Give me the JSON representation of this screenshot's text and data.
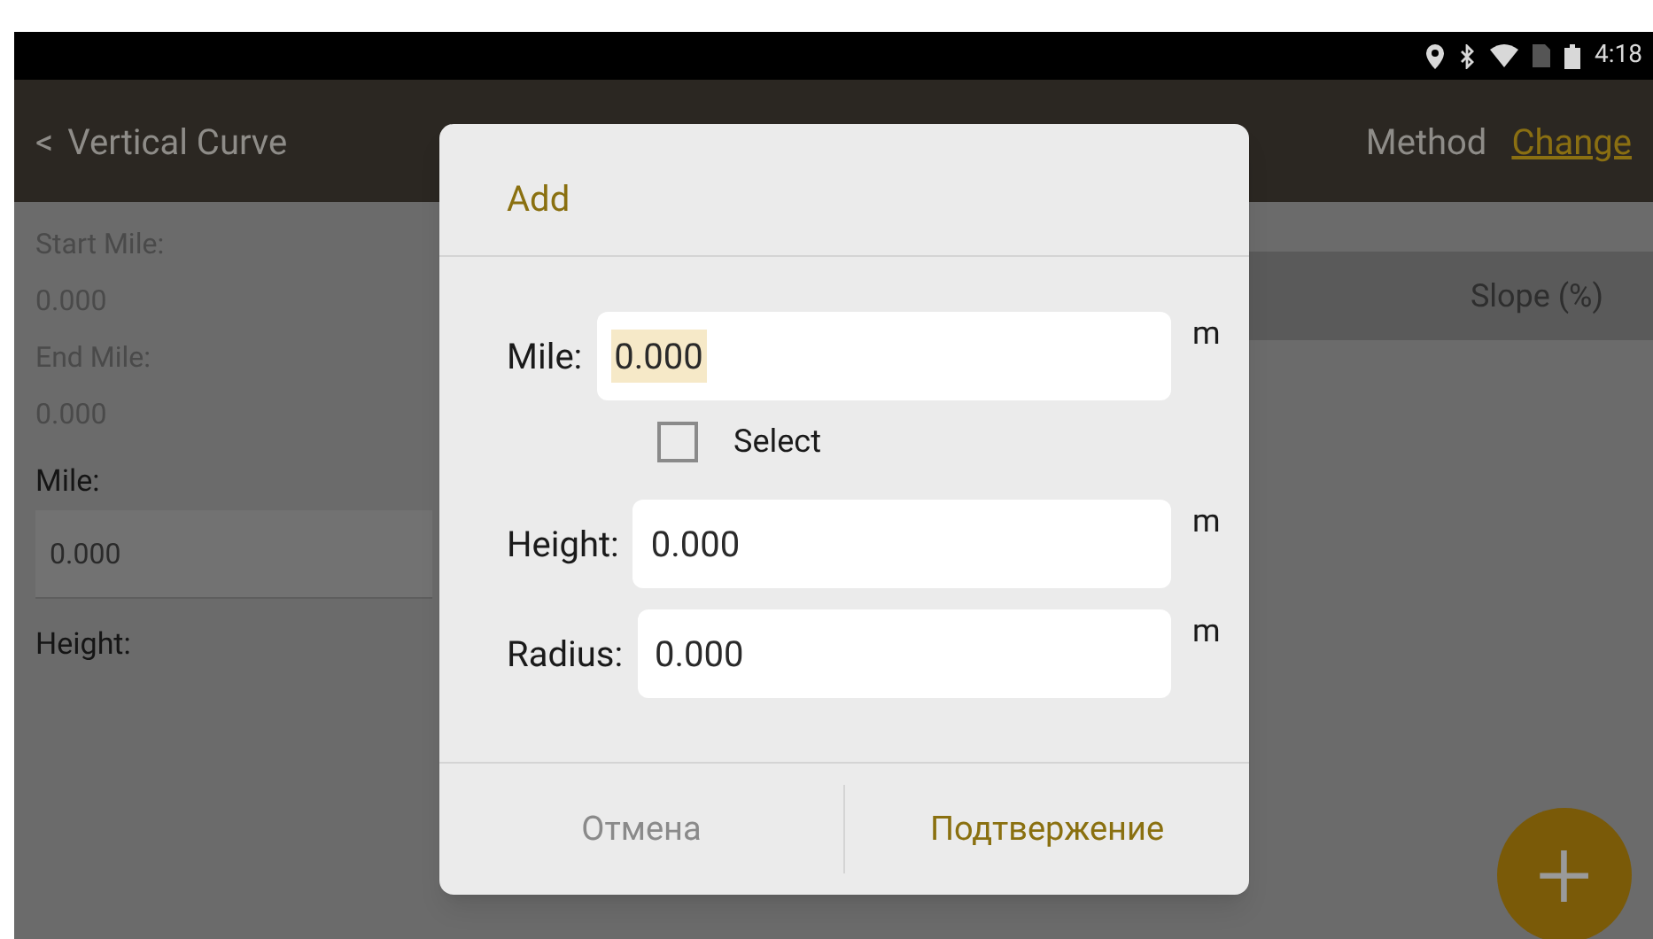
{
  "status_bar": {
    "time": "4:18"
  },
  "toolbar": {
    "back": "<",
    "title": "Vertical Curve",
    "method": "Method",
    "change": "Change"
  },
  "form": [
    {
      "kind": "label",
      "text": "Start Mile:"
    },
    {
      "kind": "value",
      "text": "0.000"
    },
    {
      "kind": "label",
      "text": "End Mile:"
    },
    {
      "kind": "value",
      "text": "0.000"
    },
    {
      "kind": "field_label",
      "text": "Mile:"
    },
    {
      "kind": "input",
      "value": "0.000"
    },
    {
      "kind": "field_label",
      "text": "Height:"
    }
  ],
  "table": {
    "columns": [
      "Slope (%)"
    ]
  },
  "fab": "+",
  "dialog": {
    "title": "Add",
    "fields": [
      {
        "kind": "input",
        "label": "Mile:",
        "value": "0.000",
        "unit": "m",
        "focused": true
      },
      {
        "kind": "checkbox",
        "label": "Select",
        "checked": false
      },
      {
        "kind": "input",
        "label": "Height:",
        "value": "0.000",
        "unit": "m",
        "focused": false
      },
      {
        "kind": "input",
        "label": "Radius:",
        "value": "0.000",
        "unit": "m",
        "focused": false
      }
    ],
    "buttons": [
      {
        "label": "Отмена",
        "primary": false
      },
      {
        "label": "Подтвержение",
        "primary": true
      }
    ]
  }
}
